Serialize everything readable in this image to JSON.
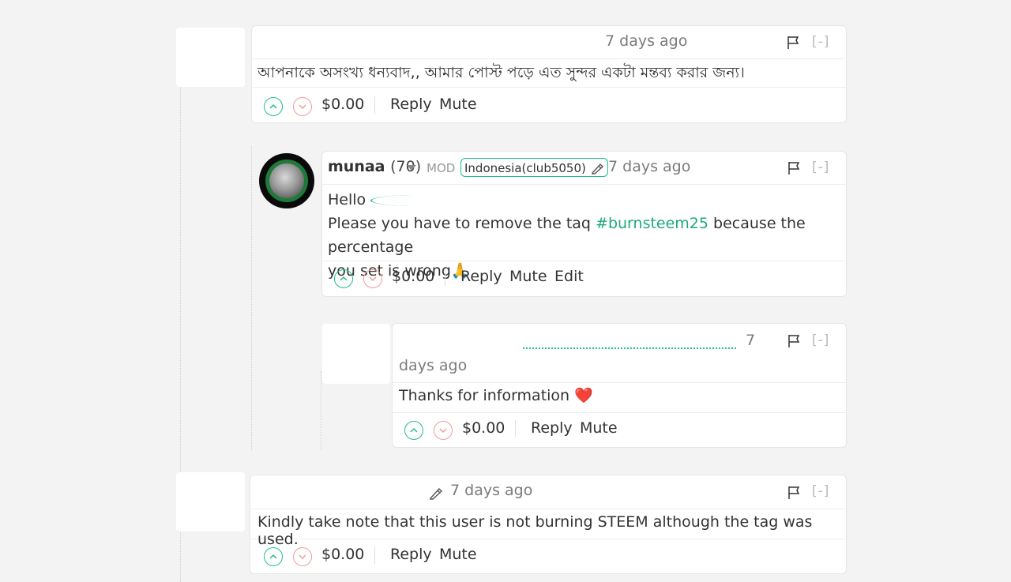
{
  "comments": [
    {
      "time": "7 days ago",
      "body": "আপনাকে অসংখ্য ধন্যবাদ,, আমার পোস্ট পড়ে এত সুন্দর একটা মন্তব্য করার জন্য।",
      "payout": "$0.00",
      "actions": [
        "Reply",
        "Mute"
      ],
      "collapse": "[-]"
    },
    {
      "author": "munaa",
      "reputation": "(70)",
      "role": "MOD",
      "community": "Indonesia(club5050)",
      "time": "7 days ago",
      "greeting": "Hello",
      "body_line1_pre": "Please you have to remove the taq ",
      "tag": "#burnsteem25",
      "body_line1_post": " because the percentage",
      "body_line2": "you set is wrong",
      "emoji": "🙏",
      "payout": "$0.00",
      "actions": [
        "Reply",
        "Mute",
        "Edit"
      ],
      "collapse": "[-]"
    },
    {
      "time_part1": "7",
      "time_part2": "days ago",
      "body": "Thanks for information",
      "emoji": "❤️",
      "payout": "$0.00",
      "actions": [
        "Reply",
        "Mute"
      ],
      "collapse": "[-]"
    },
    {
      "time": "7 days ago",
      "body": "Kindly take note that this user is not burning STEEM although the tag was used.",
      "payout": "$0.00",
      "actions": [
        "Reply",
        "Mute"
      ],
      "collapse": "[-]"
    }
  ],
  "colors": {
    "accent": "#1fbf8f",
    "downvote": "#f29a9a",
    "text": "#333333",
    "muted": "#7b7b7b"
  },
  "icons": [
    "flag-icon",
    "upvote-icon",
    "downvote-icon",
    "pencil-icon",
    "dropdown-caret-icon"
  ]
}
